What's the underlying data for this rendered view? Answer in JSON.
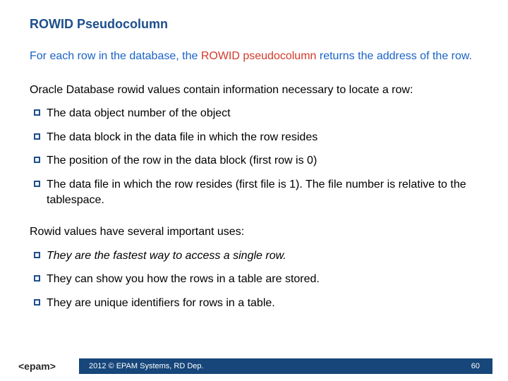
{
  "title": "ROWID Pseudocolumn",
  "intro": {
    "part1": "For each row in the database, the ",
    "highlight": "ROWID pseudocolumn",
    "part2": " returns the address of the row."
  },
  "section1": {
    "lead": "Oracle Database rowid values contain information necessary to locate a row:",
    "items": [
      "The data object number of the object",
      "The data block in the data file in which the row resides",
      "The position of the row in the data block (first row is 0)",
      "The data file in which the row resides (first file is 1). The file number is relative to the tablespace."
    ]
  },
  "section2": {
    "lead": "Rowid values have several important uses:",
    "items": [
      "They are the fastest way to access a single row.",
      "They can show you how the rows in a table are stored.",
      "They are unique identifiers for rows in a table."
    ],
    "firstItalic": true
  },
  "footer": {
    "copyright": "2012 © EPAM Systems, RD Dep.",
    "page": "60",
    "logo": "<epam>"
  }
}
